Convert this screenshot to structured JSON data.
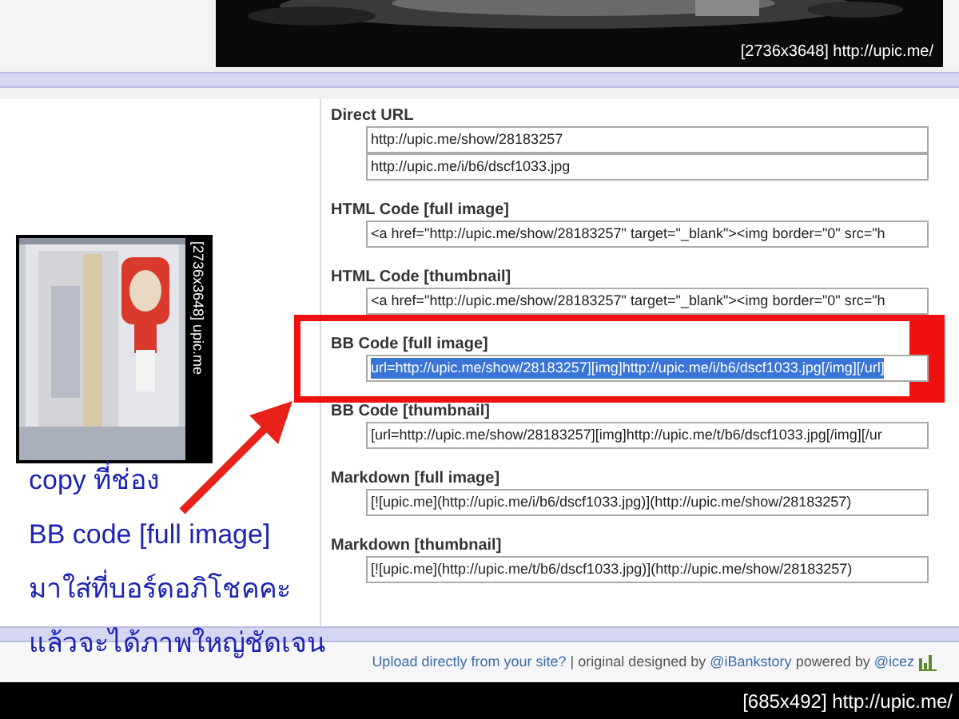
{
  "top_image": {
    "kind": "picture",
    "caption": "[2736x3648] http://upic.me/"
  },
  "thumbnail": {
    "kind": "picture",
    "caption": "[2736x3648] upic.me"
  },
  "sections": [
    {
      "label": "Direct URL",
      "highlighted": false,
      "fields": [
        {
          "value": "http://upic.me/show/28183257",
          "selected": false
        },
        {
          "value": "http://upic.me/i/b6/dscf1033.jpg",
          "selected": false
        }
      ]
    },
    {
      "label": "HTML Code [full image]",
      "highlighted": false,
      "fields": [
        {
          "value": "<a href=\"http://upic.me/show/28183257\" target=\"_blank\"><img border=\"0\" src=\"h",
          "selected": false
        }
      ]
    },
    {
      "label": "HTML Code [thumbnail]",
      "highlighted": false,
      "fields": [
        {
          "value": "<a href=\"http://upic.me/show/28183257\" target=\"_blank\"><img border=\"0\" src=\"h",
          "selected": false
        }
      ]
    },
    {
      "label": "BB Code [full image]",
      "highlighted": true,
      "fields": [
        {
          "value": "url=http://upic.me/show/28183257][img]http://upic.me/i/b6/dscf1033.jpg[/img][/url]",
          "selected": true
        }
      ]
    },
    {
      "label": "BB Code [thumbnail]",
      "highlighted": false,
      "fields": [
        {
          "value": "[url=http://upic.me/show/28183257][img]http://upic.me/t/b6/dscf1033.jpg[/img][/ur",
          "selected": false
        }
      ]
    },
    {
      "label": "Markdown [full image]",
      "highlighted": false,
      "fields": [
        {
          "value": "[![upic.me](http://upic.me/i/b6/dscf1033.jpg)](http://upic.me/show/28183257)",
          "selected": false
        }
      ]
    },
    {
      "label": "Markdown [thumbnail]",
      "highlighted": false,
      "fields": [
        {
          "value": "[![upic.me](http://upic.me/t/b6/dscf1033.jpg)](http://upic.me/show/28183257)",
          "selected": false
        }
      ]
    }
  ],
  "annotation": {
    "lines": [
      "copy ที่ช่อง",
      "BB code [full image]",
      "มาใส่ที่บอร์ดอภิโชคคะ",
      "แล้วจะได้ภาพใหญ่ชัดเจน"
    ]
  },
  "footer": {
    "parts": [
      {
        "kind": "link",
        "text": "Upload directly from your site?"
      },
      {
        "kind": "plain",
        "text": " | original designed by "
      },
      {
        "kind": "link",
        "text": "@iBankstory"
      },
      {
        "kind": "plain",
        "text": " powered by "
      },
      {
        "kind": "link",
        "text": "@icez"
      }
    ]
  },
  "bottom_caption": "[685x492] http://upic.me/"
}
